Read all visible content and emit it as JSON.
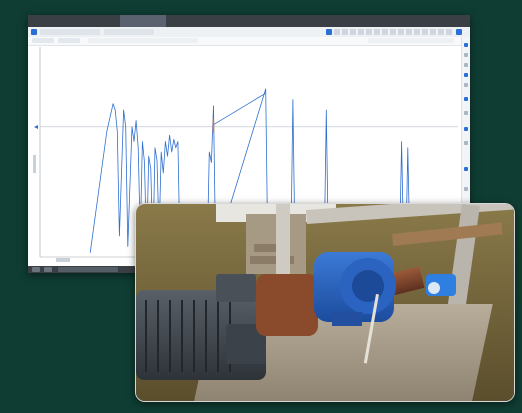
{
  "app": {
    "tabs": [
      "",
      "",
      "",
      "",
      ""
    ],
    "active_tab": 2
  },
  "chart_data": {
    "type": "line",
    "title": "",
    "xlabel": "",
    "ylabel": "",
    "color": "#2f6fd0",
    "marker_color": "#f07020",
    "reference_color": "#b8c0c8",
    "series": [
      {
        "values": [
          [
            0.12,
            0.02
          ],
          [
            0.16,
            0.6
          ],
          [
            0.175,
            0.73
          ],
          [
            0.18,
            0.7
          ],
          [
            0.185,
            0.6
          ],
          [
            0.19,
            0.1
          ],
          [
            0.2,
            0.7
          ],
          [
            0.205,
            0.62
          ],
          [
            0.21,
            0.05
          ],
          [
            0.22,
            0.62
          ],
          [
            0.225,
            0.55
          ],
          [
            0.23,
            0.65
          ],
          [
            0.235,
            0.52
          ],
          [
            0.24,
            0.1
          ],
          [
            0.245,
            0.55
          ],
          [
            0.25,
            0.45
          ],
          [
            0.255,
            0.02
          ],
          [
            0.26,
            0.48
          ],
          [
            0.265,
            0.42
          ],
          [
            0.27,
            0.02
          ],
          [
            0.275,
            0.52
          ],
          [
            0.28,
            0.46
          ],
          [
            0.285,
            0.1
          ],
          [
            0.29,
            0.5
          ],
          [
            0.295,
            0.4
          ],
          [
            0.3,
            0.55
          ],
          [
            0.305,
            0.48
          ],
          [
            0.31,
            0.58
          ],
          [
            0.315,
            0.5
          ],
          [
            0.32,
            0.56
          ],
          [
            0.325,
            0.52
          ],
          [
            0.33,
            0.55
          ],
          [
            0.335,
            0.02
          ],
          [
            0.34,
            0.02
          ],
          [
            0.4,
            0.02
          ],
          [
            0.405,
            0.5
          ],
          [
            0.41,
            0.45
          ],
          [
            0.415,
            0.72
          ],
          [
            0.42,
            0.02
          ],
          [
            0.54,
            0.8
          ],
          [
            0.545,
            0.02
          ],
          [
            0.6,
            0.02
          ],
          [
            0.605,
            0.75
          ],
          [
            0.61,
            0.02
          ],
          [
            0.68,
            0.02
          ],
          [
            0.685,
            0.7
          ],
          [
            0.69,
            0.02
          ],
          [
            0.86,
            0.02
          ],
          [
            0.865,
            0.55
          ],
          [
            0.87,
            0.02
          ],
          [
            0.875,
            0.02
          ],
          [
            0.88,
            0.52
          ],
          [
            0.885,
            0.02
          ]
        ]
      }
    ],
    "reference_line": 0.62,
    "connector": [
      [
        0.415,
        0.63
      ],
      [
        0.54,
        0.78
      ]
    ]
  }
}
